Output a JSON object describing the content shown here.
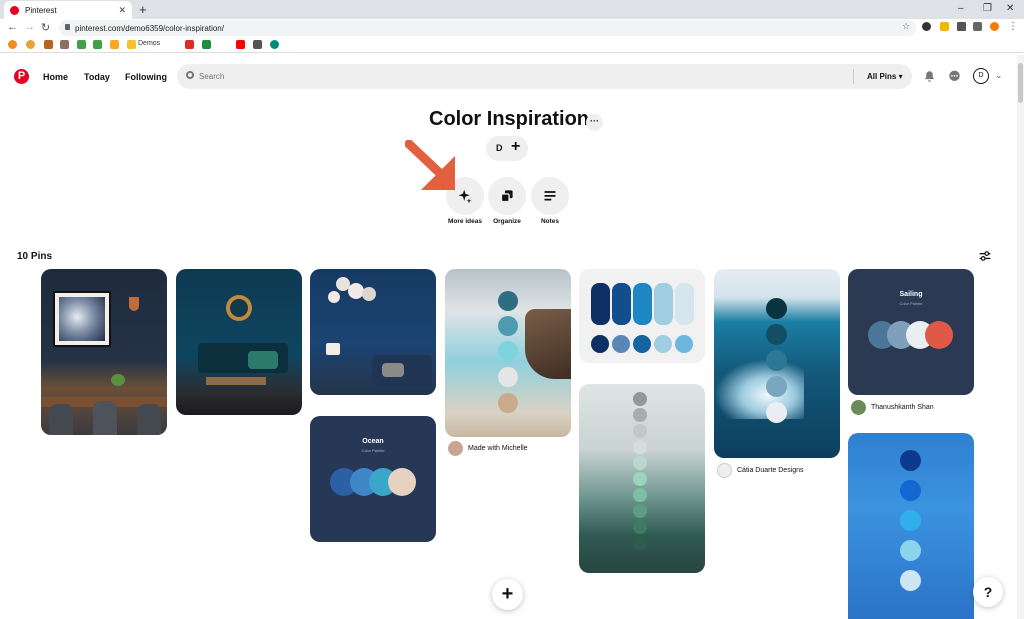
{
  "browser": {
    "tab_title": "Pinterest",
    "url": "pinterest.com/demo6359/color-inspiration/",
    "bookmark_folder": "Demos"
  },
  "header": {
    "nav": [
      "Home",
      "Today",
      "Following"
    ],
    "search_placeholder": "Search",
    "filter_label": "All Pins",
    "avatar_initial": "D"
  },
  "board": {
    "title": "Color Inspiration",
    "collaborator_initial": "D",
    "actions": [
      {
        "label": "More ideas",
        "icon": "sparkle-icon"
      },
      {
        "label": "Organize",
        "icon": "organize-icon"
      },
      {
        "label": "Notes",
        "icon": "notes-icon"
      }
    ],
    "pin_count": "10 Pins"
  },
  "pins": {
    "ocean": {
      "title": "Ocean",
      "subtitle": "Color Palette"
    },
    "sailing": {
      "title": "Sailing",
      "subtitle": "Color Palette"
    },
    "authors": [
      "Made with Michelle",
      "Cátia Duarte Designs",
      "Thanushkanth Shan"
    ]
  },
  "colors": {
    "brand": "#e60023",
    "arrow": "#e2603f",
    "navy": "#263856"
  }
}
